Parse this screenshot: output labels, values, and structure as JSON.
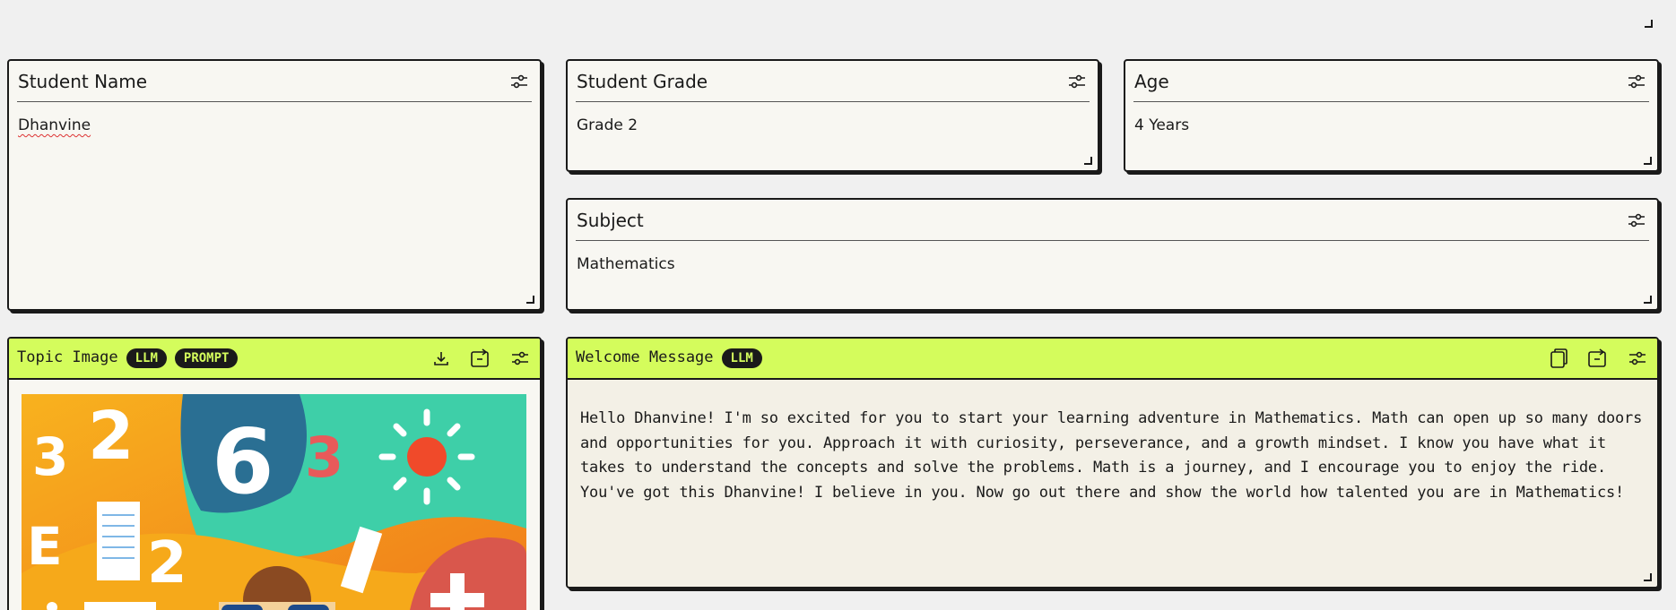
{
  "student_name": {
    "title": "Student Name",
    "value": "Dhanvine"
  },
  "student_grade": {
    "title": "Student Grade",
    "value": "Grade 2"
  },
  "age": {
    "title": "Age",
    "value": "4 Years"
  },
  "subject": {
    "title": "Subject",
    "value": "Mathematics"
  },
  "topic_image": {
    "title": "Topic Image",
    "badges": [
      "LLM",
      "PROMPT"
    ],
    "digits": [
      "3",
      "2",
      "6",
      "3",
      "E",
      "2"
    ]
  },
  "welcome": {
    "title": "Welcome Message",
    "badge": "LLM",
    "message": "Hello Dhanvine! I'm so excited for you to start your learning adventure in Mathematics. Math can open up so many doors and opportunities for you. Approach it with curiosity, perseverance, and a growth mindset. I know you have what it takes to understand the concepts and solve the problems. Math is a journey, and I encourage you to enjoy the ride. You've got this Dhanvine! I believe in you. Now go out there and show the world how talented you are in Mathematics!"
  },
  "colors": {
    "accent": "#d4fc5c",
    "card_bg": "#f8f7f2",
    "page_bg": "#f0f0f0",
    "ink": "#1a1a1a"
  },
  "icons": [
    "settings-sliders-icon",
    "download-icon",
    "share-icon",
    "copy-icon",
    "resize-handle-icon"
  ]
}
